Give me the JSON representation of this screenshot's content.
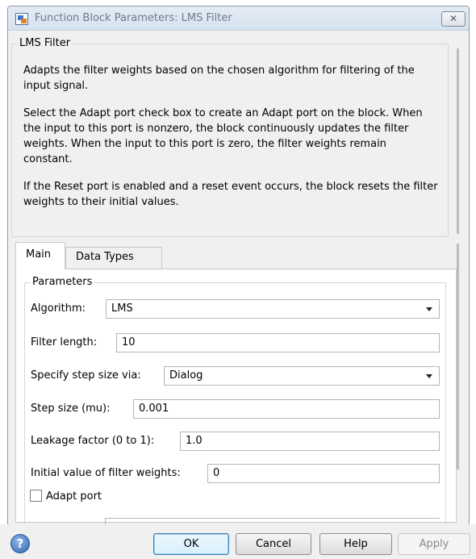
{
  "window": {
    "title": "Function Block Parameters: LMS Filter",
    "close_glyph": "✕"
  },
  "description": {
    "group_label": "LMS Filter",
    "paragraphs": [
      "Adapts the filter weights based on the chosen algorithm for filtering of the input signal.",
      "Select the Adapt port check box to create an Adapt port on the block. When the input to this port is nonzero, the block continuously updates the filter weights. When the input to this port is zero, the filter weights remain constant.",
      "If the Reset port is enabled and a reset event occurs, the block resets the filter weights to their initial values."
    ]
  },
  "tabs": [
    {
      "label": "Main",
      "active": true
    },
    {
      "label": "Data Types",
      "active": false
    }
  ],
  "parameters": {
    "group_label": "Parameters",
    "algorithm": {
      "label": "Algorithm:",
      "value": "LMS"
    },
    "filter_length": {
      "label": "Filter length:",
      "value": "10"
    },
    "step_size_via": {
      "label": "Specify step size via:",
      "value": "Dialog"
    },
    "step_size": {
      "label": "Step size (mu):",
      "value": "0.001"
    },
    "leakage": {
      "label": "Leakage factor (0 to 1):",
      "value": "1.0"
    },
    "initial_weights": {
      "label": "Initial value of filter weights:",
      "value": "0"
    },
    "adapt_port": {
      "label": "Adapt port",
      "checked": false
    }
  },
  "buttons": {
    "help_icon_glyph": "?",
    "ok": "OK",
    "cancel": "Cancel",
    "help": "Help",
    "apply": "Apply"
  }
}
